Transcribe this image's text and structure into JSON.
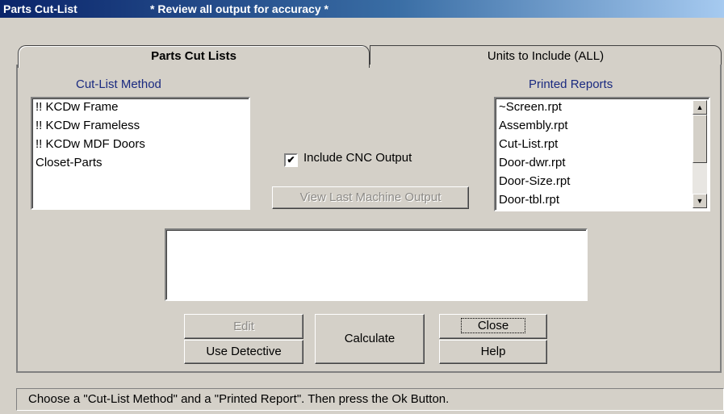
{
  "window": {
    "title": "Parts Cut-List",
    "subtitle": "* Review all output for accuracy *"
  },
  "tabs": [
    {
      "label": "Parts Cut Lists",
      "active": true
    },
    {
      "label": "Units to Include (ALL)",
      "active": false
    }
  ],
  "cutlist": {
    "label": "Cut-List Method",
    "items": [
      "!! KCDw Frame",
      "!! KCDw Frameless",
      "!! KCDw MDF Doors",
      "Closet-Parts"
    ]
  },
  "reports": {
    "label": "Printed Reports",
    "items": [
      "~Screen.rpt",
      "Assembly.rpt",
      "Cut-List.rpt",
      "Door-dwr.rpt",
      "Door-Size.rpt",
      "Door-tbl.rpt"
    ]
  },
  "cnc": {
    "label": "Include CNC Output",
    "checked": true,
    "view_button": "View Last Machine Output"
  },
  "buttons": {
    "edit": "Edit",
    "detective": "Use Detective",
    "calculate": "Calculate",
    "close": "Close",
    "help": "Help"
  },
  "status": "Choose a \"Cut-List Method\" and a \"Printed Report\". Then press the Ok Button.",
  "colors": {
    "title_gradient_start": "#0a246a",
    "label_blue": "#1a2a80",
    "face": "#d4d0c8"
  }
}
